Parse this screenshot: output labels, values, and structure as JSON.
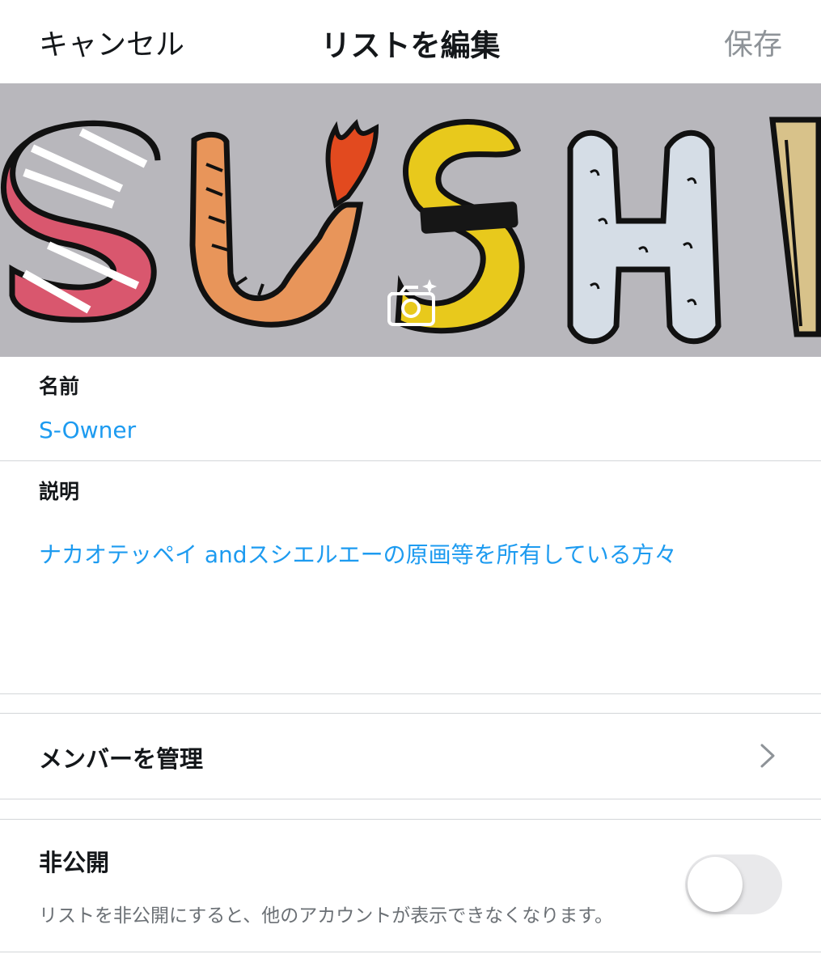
{
  "navbar": {
    "cancel_label": "キャンセル",
    "title": "リストを編集",
    "save_label": "保存"
  },
  "banner": {
    "image_description": "SUSHI lettering made of sushi",
    "camera_icon": "camera-add-icon"
  },
  "name_field": {
    "label": "名前",
    "value": "S-Owner"
  },
  "description_field": {
    "label": "説明",
    "value": "ナカオテッペイ andスシエルエーの原画等を所有している方々"
  },
  "manage_members": {
    "label": "メンバーを管理",
    "icon": "chevron-right-icon"
  },
  "private_setting": {
    "title": "非公開",
    "description": "リストを非公開にすると、他のアカウントが表示できなくなります。",
    "enabled": false
  },
  "colors": {
    "accent": "#1d9bf0",
    "text": "#14171a",
    "secondary_text": "#6b7075",
    "disabled_action": "#8e9398",
    "divider": "#d3d6d9",
    "toggle_off": "#e9e9eb"
  }
}
